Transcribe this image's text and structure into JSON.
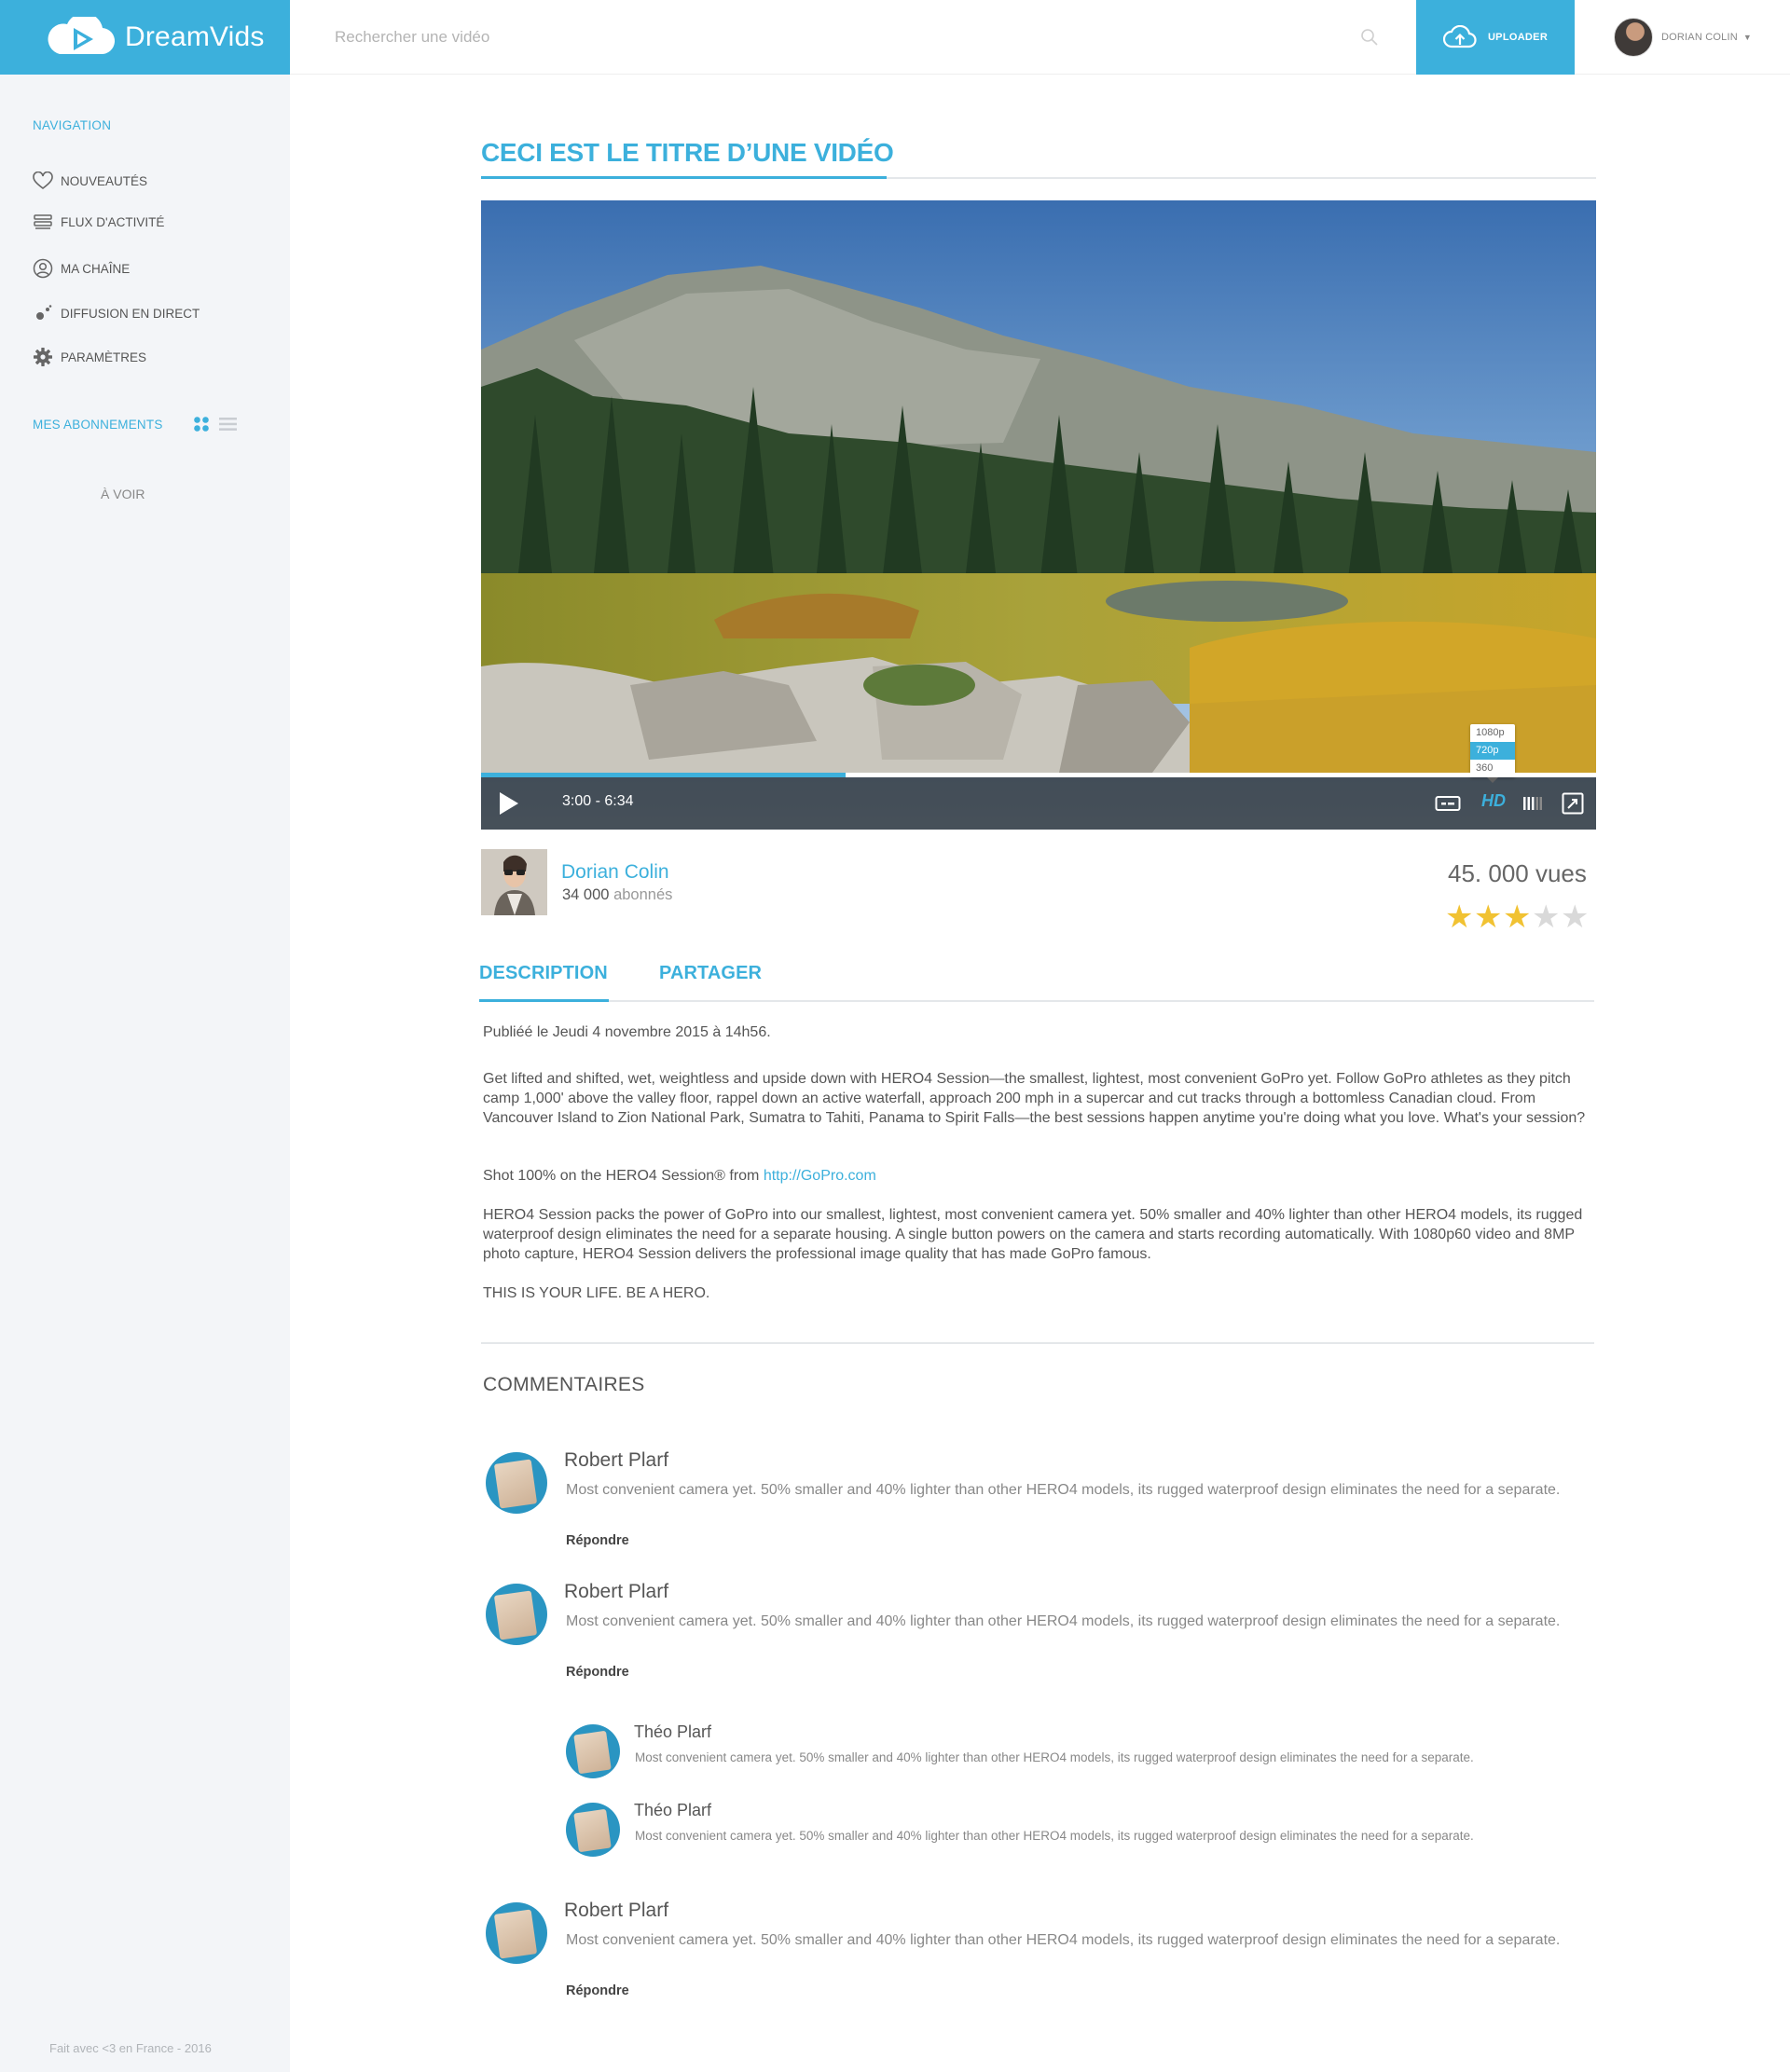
{
  "app": {
    "logo_text": "DreamVids"
  },
  "search": {
    "placeholder": "Rechercher une vidéo"
  },
  "header": {
    "upload_label": "UPLOADER",
    "user_name": "DORIAN COLIN",
    "caret": "▼"
  },
  "sidebar": {
    "nav_title": "NAVIGATION",
    "items": [
      {
        "label": "NOUVEAUTÉS",
        "icon": "heart-icon"
      },
      {
        "label": "FLUX D'ACTIVITÉ",
        "icon": "stack-icon"
      },
      {
        "label": "MA CHAÎNE",
        "icon": "user-circle-icon"
      },
      {
        "label": "DIFFUSION EN DIRECT",
        "icon": "broadcast-icon"
      },
      {
        "label": "PARAMÈTRES",
        "icon": "gear-icon"
      }
    ],
    "subscriptions_title": "MES ABONNEMENTS",
    "a_voir": "À VOIR",
    "footer": "Fait avec <3 en France - 2016"
  },
  "video": {
    "title": "CECI EST LE TITRE D’UNE VIDÉO",
    "time": "3:00 - 6:34",
    "progress": 0.327,
    "quality_label": "HD",
    "quality_options": [
      "1080p",
      "720p",
      "360"
    ],
    "quality_selected": "720p"
  },
  "author": {
    "name": "Dorian Colin",
    "subs_count": "34 000",
    "subs_label": "abonnés"
  },
  "stats": {
    "views": "45. 000 vues",
    "rating": 3,
    "rating_max": 5
  },
  "tabs": {
    "description": "DESCRIPTION",
    "share": "PARTAGER"
  },
  "description": {
    "published": "Publiéé le Jeudi 4 novembre 2015 à 14h56.",
    "p1": "Get lifted and shifted, wet, weightless and upside down with HERO4 Session—the smallest, lightest, most convenient GoPro yet. Follow GoPro athletes as they pitch camp 1,000' above the valley floor, rappel down an active waterfall, approach 200 mph in a supercar and cut tracks through a bottomless Canadian cloud. From Vancouver Island to Zion National Park, Sumatra to Tahiti, Panama to Spirit Falls—the best sessions happen anytime you're doing what you love. What's your session?",
    "shot_prefix": "Shot 100% on the HERO4 Session® from ",
    "shot_link": "http://GoPro.com",
    "p2": "HERO4 Session packs the power of GoPro into our smallest, lightest, most convenient camera yet. 50% smaller and 40% lighter than other HERO4 models, its rugged waterproof design eliminates the need for a separate housing. A single button powers on the camera and starts recording automatically. With 1080p60 video and 8MP photo capture, HERO4 Session delivers the professional image quality that has made GoPro famous.",
    "p3": "THIS IS YOUR LIFE. BE A HERO."
  },
  "comments": {
    "title": "COMMENTAIRES",
    "reply_label": "Répondre",
    "items": [
      {
        "author": "Robert Plarf",
        "text": "Most convenient camera yet. 50% smaller and 40% lighter than other HERO4 models, its rugged waterproof design eliminates the need for a separate."
      },
      {
        "author": "Robert Plarf",
        "text": "Most convenient camera yet. 50% smaller and 40% lighter than other HERO4 models, its rugged waterproof design eliminates the need for a separate."
      },
      {
        "author": "Robert Plarf",
        "text": "Most convenient camera yet. 50% smaller and 40% lighter than other HERO4 models, its rugged waterproof design eliminates the need for a separate."
      }
    ],
    "replies": [
      {
        "author": "Théo Plarf",
        "text": "Most convenient camera yet. 50% smaller and 40% lighter than other HERO4 models, its rugged waterproof design eliminates the need for a separate."
      },
      {
        "author": "Théo Plarf",
        "text": "Most convenient camera yet. 50% smaller and 40% lighter than other HERO4 models, its rugged waterproof design eliminates the need for a separate."
      }
    ]
  },
  "colors": {
    "accent": "#3cb0dc",
    "sidebar_bg": "#f3f5f8",
    "star_on": "#f1c232",
    "star_off": "#d9d9d9"
  }
}
